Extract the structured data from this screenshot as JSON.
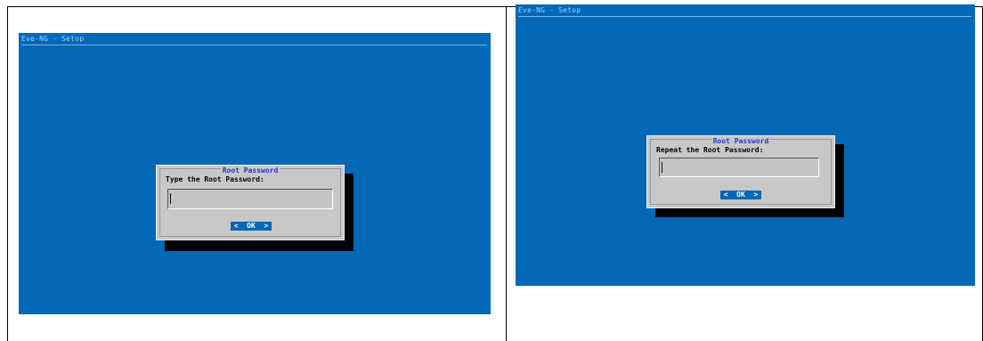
{
  "screens": [
    {
      "window_title": "Eve-NG - Setop",
      "dialog": {
        "title": "Root Password",
        "prompt": "Type the Root Password:",
        "password_value": "",
        "ok_label": "<  OK  >"
      }
    },
    {
      "window_title": "Eve-NG - Setop",
      "dialog": {
        "title": "Root Password",
        "prompt": "Repeat the Root Password:",
        "password_value": "",
        "ok_label": "<  OK  >"
      }
    }
  ],
  "colors": {
    "screen_background": "#0468b6",
    "dialog_background": "#c8c8c8",
    "dialog_title": "#1b3bd8",
    "button_background": "#0468b6"
  }
}
